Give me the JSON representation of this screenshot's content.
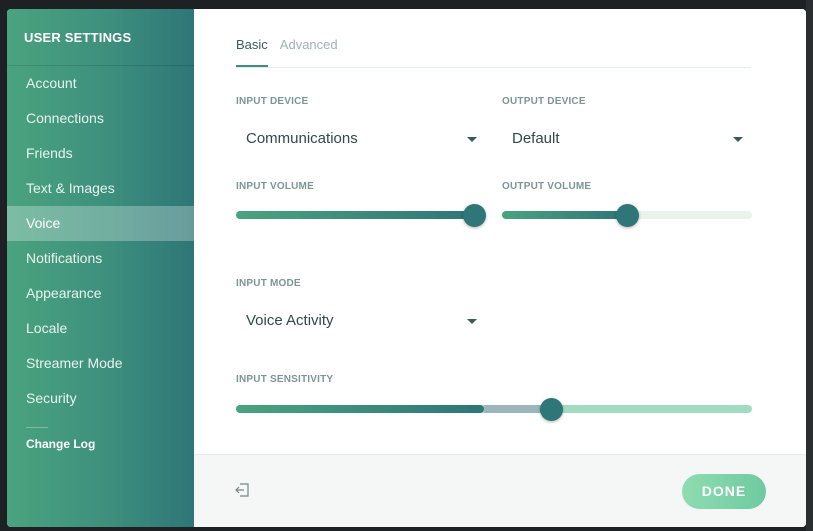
{
  "sidebar": {
    "title": "USER SETTINGS",
    "items": [
      {
        "label": "Account",
        "active": false
      },
      {
        "label": "Connections",
        "active": false
      },
      {
        "label": "Friends",
        "active": false
      },
      {
        "label": "Text & Images",
        "active": false
      },
      {
        "label": "Voice",
        "active": true
      },
      {
        "label": "Notifications",
        "active": false
      },
      {
        "label": "Appearance",
        "active": false
      },
      {
        "label": "Locale",
        "active": false
      },
      {
        "label": "Streamer Mode",
        "active": false
      },
      {
        "label": "Security",
        "active": false
      }
    ],
    "changelog": "Change Log"
  },
  "tabs": [
    {
      "label": "Basic",
      "active": true
    },
    {
      "label": "Advanced",
      "active": false
    }
  ],
  "input_device": {
    "label": "INPUT DEVICE",
    "value": "Communications",
    "icon": "chevron-down-icon"
  },
  "output_device": {
    "label": "OUTPUT DEVICE",
    "value": "Default",
    "icon": "chevron-down-icon"
  },
  "input_volume": {
    "label": "INPUT VOLUME",
    "level": 0.95
  },
  "output_volume": {
    "label": "OUTPUT VOLUME",
    "level": 0.5
  },
  "input_mode": {
    "label": "INPUT MODE",
    "value": "Voice Activity",
    "icon": "chevron-down-icon"
  },
  "input_sensitivity": {
    "label": "INPUT SENSITIVITY",
    "level": 0.61,
    "meter_level": 0.48
  },
  "footer": {
    "logout_icon": "logout-icon",
    "done_label": "DONE"
  },
  "colors": {
    "accent": "#2e7677",
    "accent_light": "#4aa37f",
    "done": "#7fd3a9",
    "track_light": "#e8f3e9",
    "track_sens": "#a2dbc2"
  }
}
